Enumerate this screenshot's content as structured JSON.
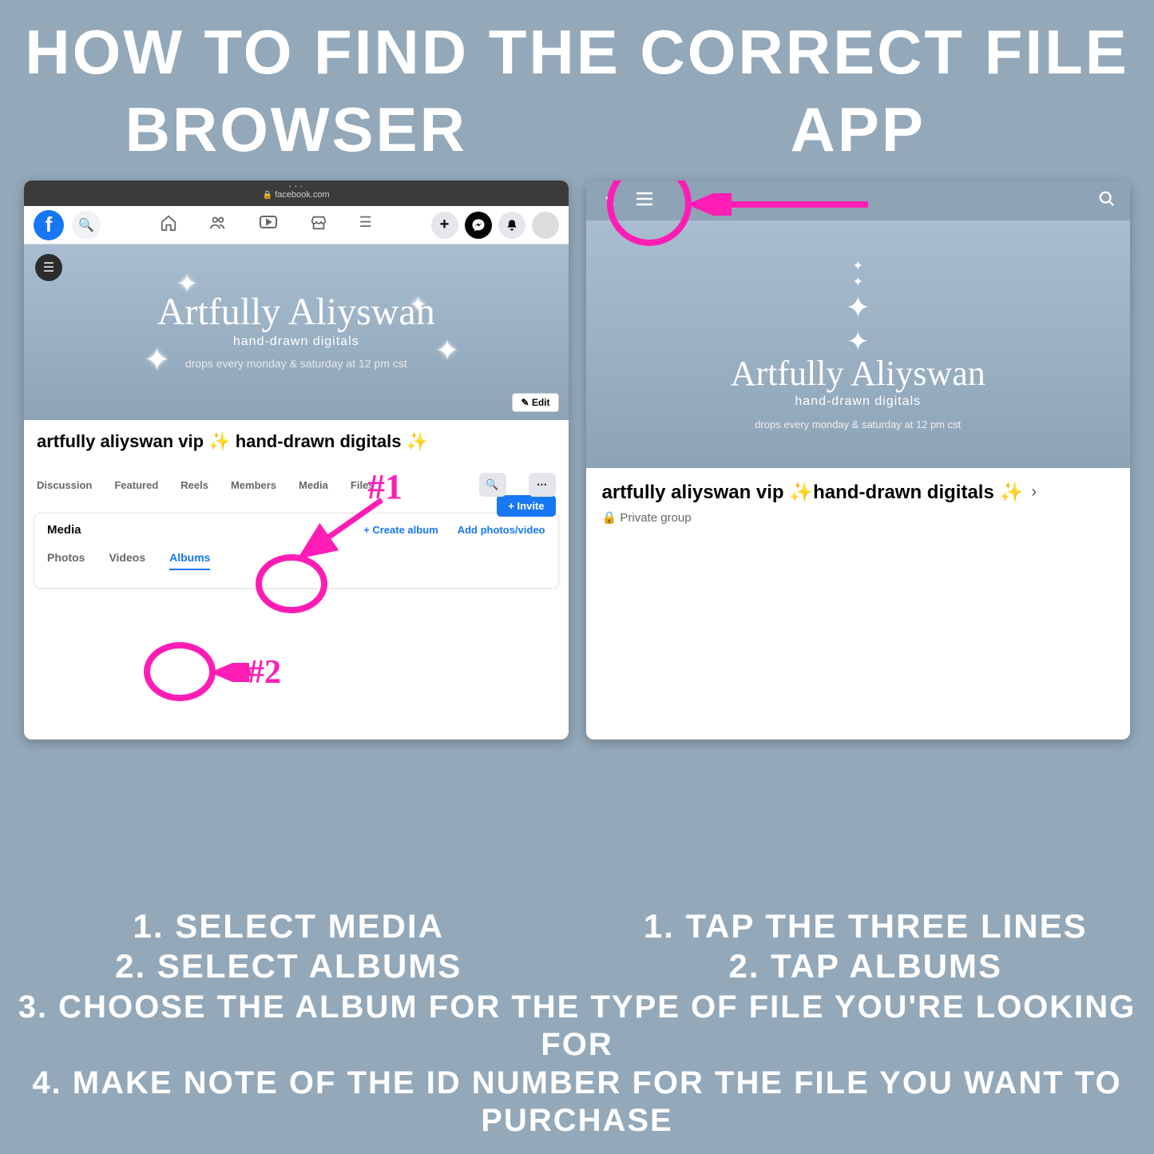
{
  "heading": "HOW TO FIND THE CORRECT FILE",
  "browser": {
    "title": "BROWSER",
    "url": "facebook.com",
    "banner": {
      "brand": "Artfully Aliyswan",
      "sub": "hand-drawn digitals",
      "line": "drops every monday & saturday at 12 pm cst",
      "edit": "✎ Edit"
    },
    "group_title": "artfully aliyswan vip ✨ hand-drawn digitals ✨",
    "invite": "+ Invite",
    "tabs": [
      "Discussion",
      "Featured",
      "Reels",
      "Members",
      "Media",
      "Files"
    ],
    "media_header": "Media",
    "media_links": {
      "create": "+  Create album",
      "add": "Add photos/video"
    },
    "subtabs": [
      "Photos",
      "Videos",
      "Albums"
    ],
    "annotations": {
      "one": "#1",
      "two": "#2"
    }
  },
  "app": {
    "title": "APP",
    "banner": {
      "brand": "Artfully Aliyswan",
      "sub": "hand-drawn digitals",
      "line": "drops every monday & saturday at 12 pm cst"
    },
    "group_title_l1": "artfully aliyswan vip ✨",
    "group_title_l2": "hand-drawn digitals ✨",
    "privacy": "Private group"
  },
  "instructions": {
    "browser": [
      "1. SELECT MEDIA",
      "2. SELECT ALBUMS"
    ],
    "app": [
      "1. TAP THE THREE LINES",
      "2. TAP ALBUMS"
    ],
    "shared": [
      "3. CHOOSE THE ALBUM FOR THE TYPE OF FILE YOU'RE LOOKING FOR",
      "4. MAKE NOTE OF THE ID NUMBER FOR THE FILE YOU WANT TO PURCHASE"
    ]
  }
}
